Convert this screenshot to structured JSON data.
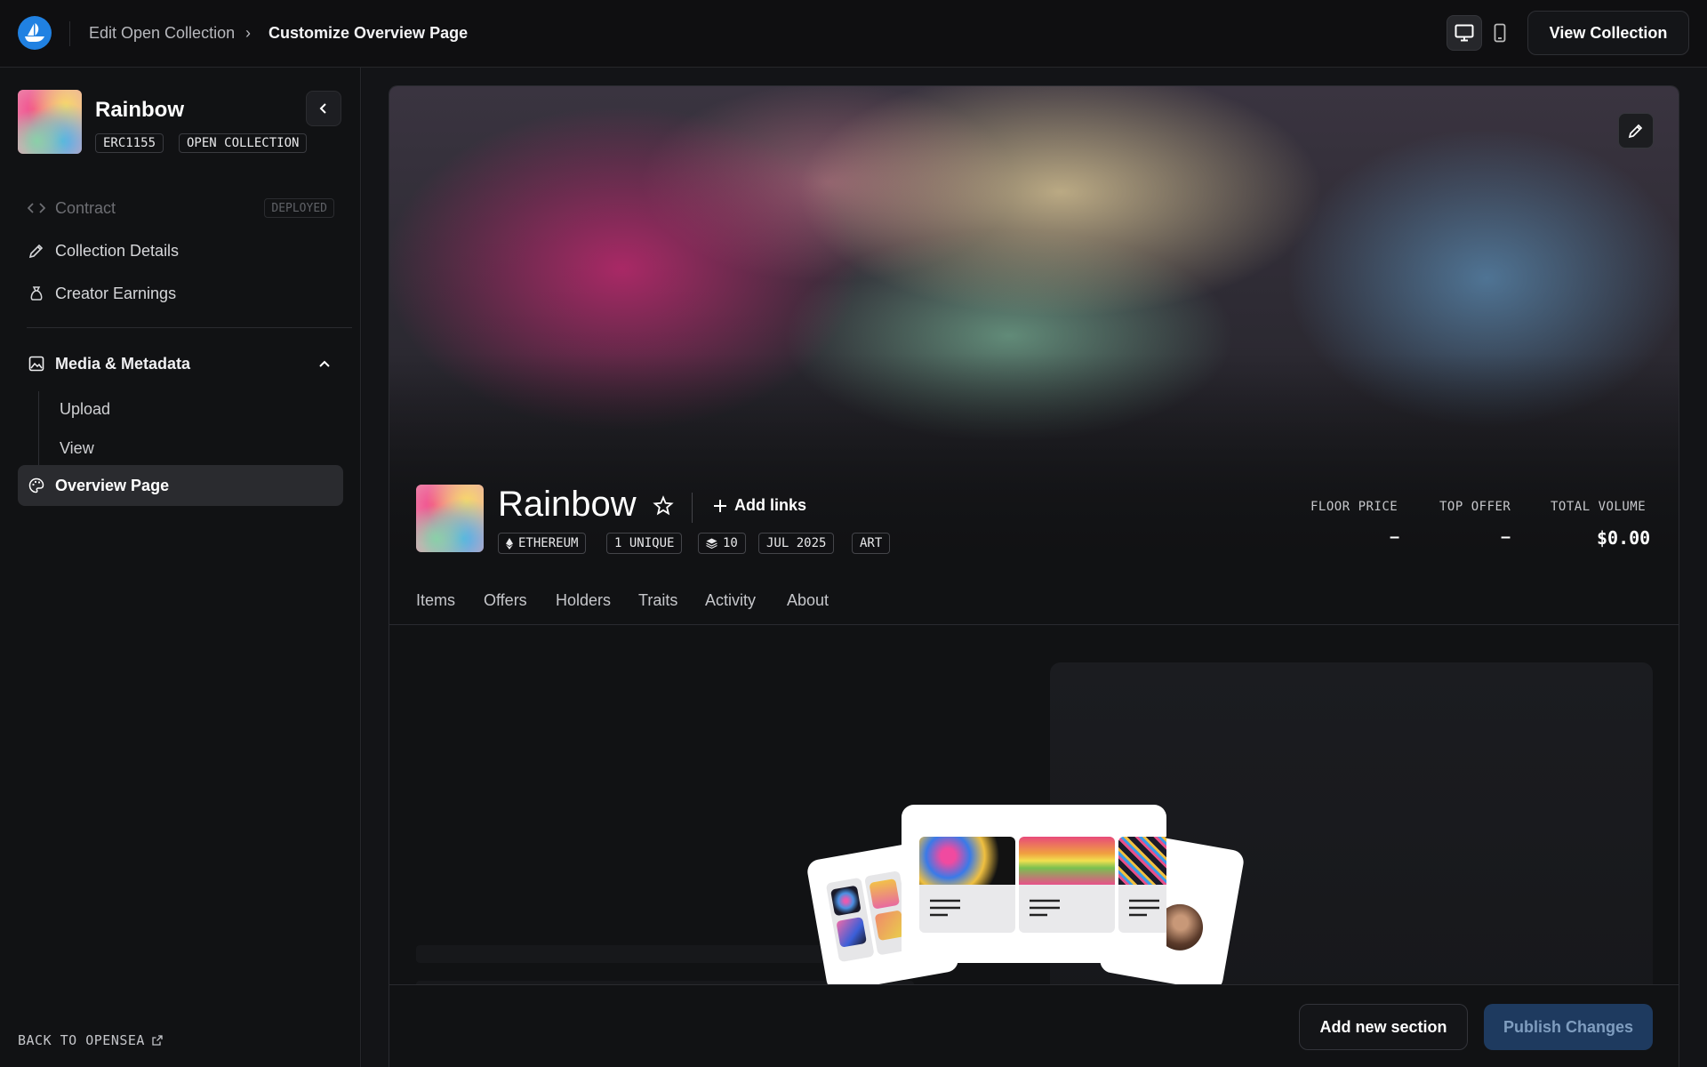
{
  "topbar": {
    "breadcrumb_parent": "Edit Open Collection",
    "breadcrumb_sep": "›",
    "breadcrumb_current": "Customize Overview Page",
    "view_collection_label": "View Collection",
    "icons": [
      "opensea-logo-icon",
      "desktop-icon",
      "mobile-icon"
    ]
  },
  "sidebar": {
    "collection_name": "Rainbow",
    "tags": [
      "ERC1155",
      "OPEN COLLECTION"
    ],
    "items": {
      "contract": {
        "label": "Contract",
        "badge": "DEPLOYED",
        "icon": "code-icon"
      },
      "details": {
        "label": "Collection Details",
        "icon": "pencil-icon"
      },
      "earnings": {
        "label": "Creator Earnings",
        "icon": "money-bag-icon"
      },
      "media": {
        "label": "Media & Metadata",
        "icon": "image-icon"
      },
      "upload": {
        "label": "Upload"
      },
      "view": {
        "label": "View"
      },
      "overview": {
        "label": "Overview Page",
        "icon": "palette-icon"
      }
    },
    "back_label": "BACK TO OPENSEA"
  },
  "header": {
    "name": "Rainbow",
    "add_links_label": "Add links",
    "tags": [
      "ETHEREUM",
      "1 UNIQUE",
      "10",
      "JUL 2025",
      "ART"
    ],
    "stats": [
      {
        "label": "FLOOR PRICE",
        "value": "–"
      },
      {
        "label": "TOP OFFER",
        "value": "–"
      },
      {
        "label": "TOTAL VOLUME",
        "value": "$0.00"
      }
    ]
  },
  "tabs": [
    "Items",
    "Offers",
    "Holders",
    "Traits",
    "Activity",
    "About"
  ],
  "footer": {
    "add_section_label": "Add new section",
    "publish_label": "Publish Changes"
  },
  "colors": {
    "accent": "#2081e2",
    "publish_bg": "#1e3a5f",
    "background": "#111214"
  }
}
